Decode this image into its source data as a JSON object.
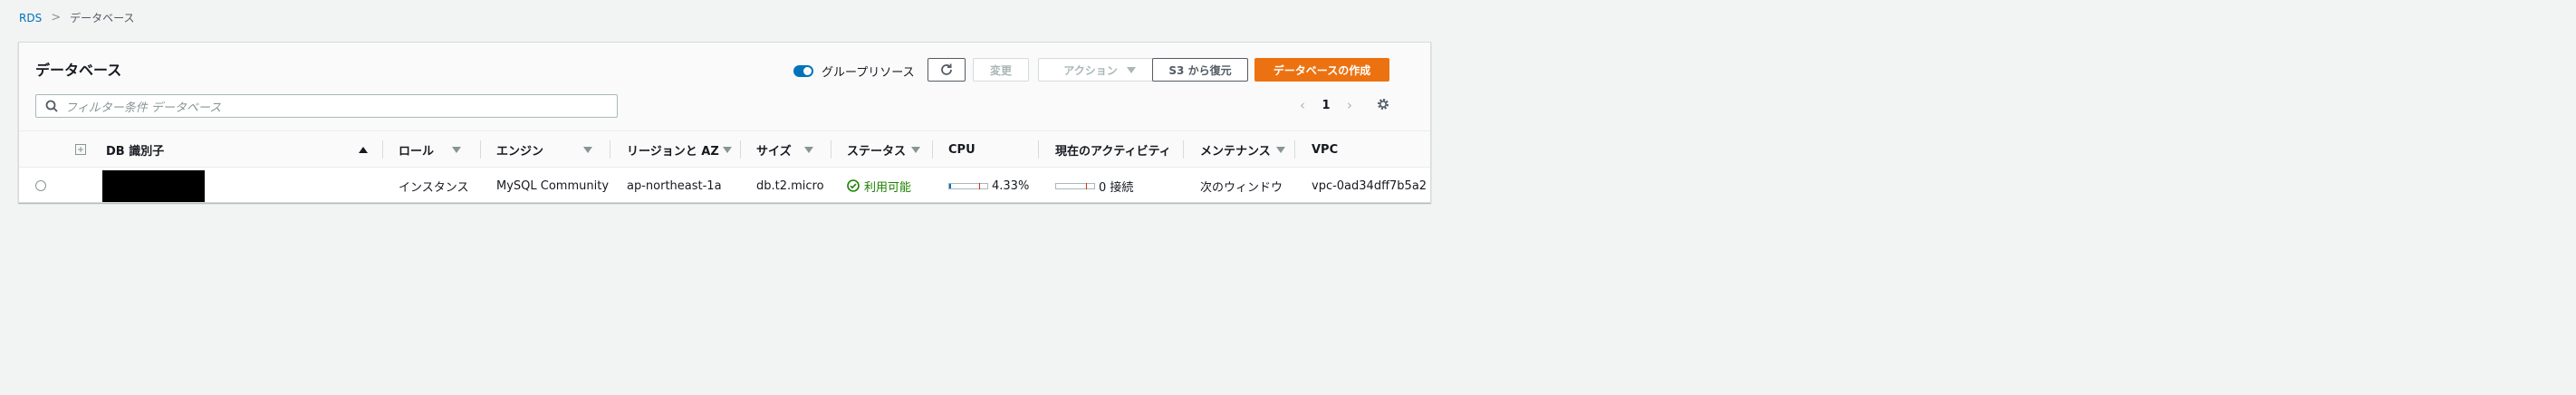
{
  "breadcrumb": {
    "root": "RDS",
    "separator": ">",
    "current": "データベース"
  },
  "panel": {
    "title": "データベース"
  },
  "toolbar": {
    "group_toggle_label": "グループリソース",
    "change_label": "変更",
    "action_label": "アクション",
    "restore_s3_label": "S3 から復元",
    "create_label": "データベースの作成"
  },
  "search": {
    "placeholder": "フィルター条件 データベース"
  },
  "pagination": {
    "page": "1"
  },
  "table": {
    "columns": {
      "db_id": "DB 識別子",
      "role": "ロール",
      "engine": "エンジン",
      "region": "リージョンと AZ",
      "size": "サイズ",
      "status": "ステータス",
      "cpu": "CPU",
      "activity": "現在のアクティビティ",
      "maintenance": "メンテナンス",
      "vpc": "VPC"
    },
    "rows": [
      {
        "role": "インスタンス",
        "engine": "MySQL Community",
        "region": "ap-northeast-1a",
        "size": "db.t2.micro",
        "status": "利用可能",
        "cpu_text": "4.33%",
        "cpu_value": 4.33,
        "activity": "0 接続",
        "maintenance": "次のウィンドウ",
        "vpc": "vpc-0ad34dff7b5a2"
      }
    ]
  },
  "icons": {
    "refresh": "refresh-icon",
    "search": "search-icon",
    "settings": "gear-icon",
    "expand": "expand-icon",
    "status_ok": "check-circle-icon"
  },
  "colors": {
    "link": "#0073bb",
    "primary": "#ec7211",
    "success": "#1d8102",
    "toggle": "#0073bb"
  }
}
